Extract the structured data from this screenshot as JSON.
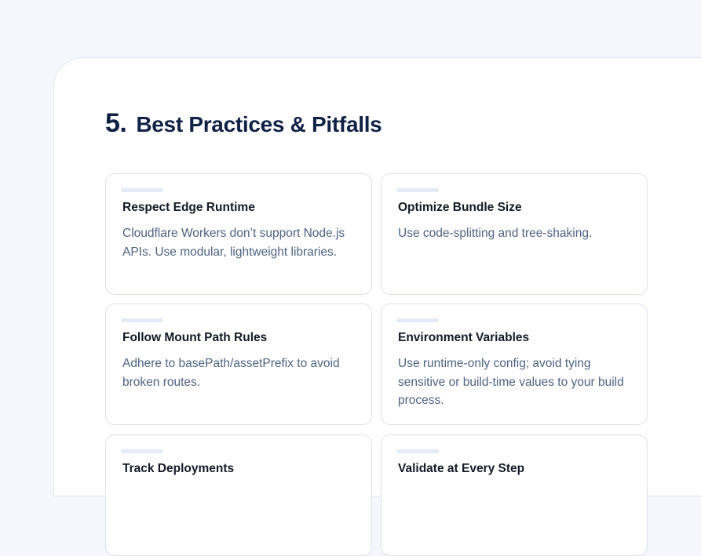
{
  "section": {
    "number": "5.",
    "title": "Best Practices & Pitfalls"
  },
  "cards": [
    {
      "title": "Respect Edge Runtime",
      "body": "Cloudflare Workers don’t support Node.js APIs. Use modular, lightweight libraries."
    },
    {
      "title": "Optimize Bundle Size",
      "body": "Use code-splitting and tree-shaking."
    },
    {
      "title": "Follow Mount Path Rules",
      "body": "Adhere to basePath/assetPrefix to avoid broken routes."
    },
    {
      "title": "Environment Variables",
      "body": "Use runtime-only config; avoid tying sensitive or build-time values to your build process."
    },
    {
      "title": "Track Deployments",
      "body": ""
    },
    {
      "title": "Validate at Every Step",
      "body": ""
    }
  ]
}
